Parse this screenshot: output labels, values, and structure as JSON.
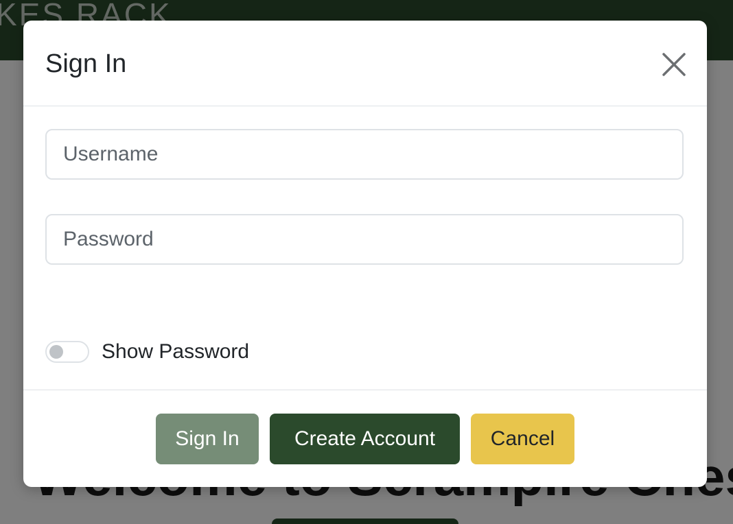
{
  "background": {
    "brand": "KES RACK",
    "welcome": "Welcome to Scrampire Chess"
  },
  "modal": {
    "title": "Sign In",
    "close_icon": "close-icon",
    "username": {
      "value": "",
      "placeholder": "Username"
    },
    "password": {
      "value": "",
      "placeholder": "Password"
    },
    "show_password": {
      "label": "Show Password",
      "checked": false
    },
    "buttons": {
      "sign_in": "Sign In",
      "create_account": "Create Account",
      "cancel": "Cancel"
    }
  },
  "colors": {
    "brand_green": "#2b4a2c",
    "muted_green": "#768d77",
    "cancel_yellow": "#e8c54c"
  }
}
